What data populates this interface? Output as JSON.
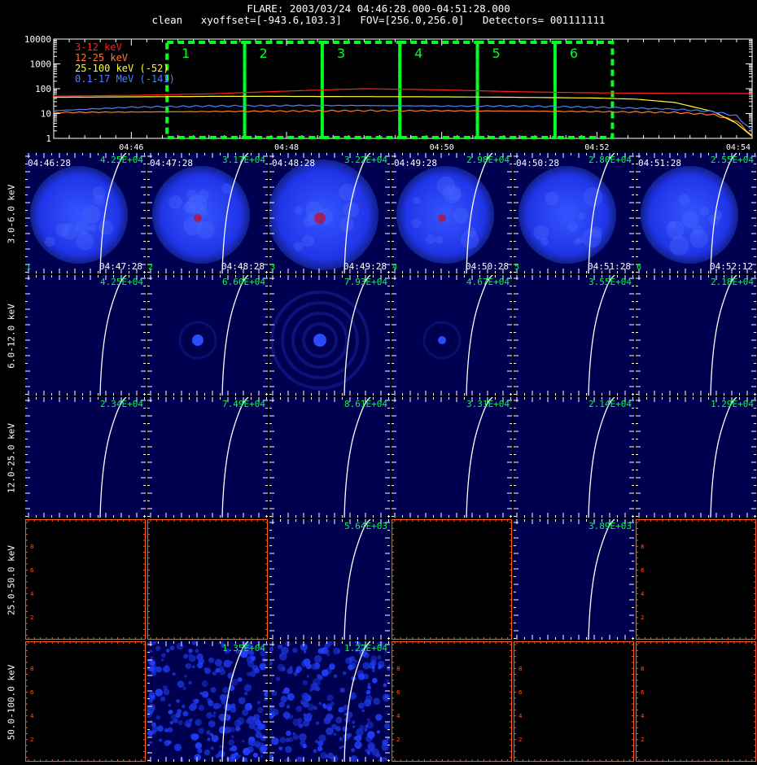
{
  "header": {
    "line1": "FLARE: 2003/03/24 04:46:28.000-04:51:28.000",
    "line2": "clean   xyoffset=[-943.6,103.3]   FOV=[256.0,256.0]   Detectors= 001111111"
  },
  "chart_data": [
    {
      "type": "line",
      "yscale": "log",
      "ylim": [
        1,
        10000
      ],
      "y_ticks": [
        "1",
        "10",
        "100",
        "1000",
        "10000"
      ],
      "x_ticks": [
        "04:46",
        "04:48",
        "04:50",
        "04:52",
        "04:54"
      ],
      "xlim_minutes": [
        0,
        9
      ],
      "x_minutes_of": "04:45",
      "series": [
        {
          "name": "3-12 keV",
          "color": "#ff2020",
          "x": [
            0,
            1,
            2,
            3,
            3.5,
            4,
            5,
            6,
            7,
            8,
            9
          ],
          "values": [
            50,
            54,
            62,
            80,
            90,
            100,
            90,
            75,
            68,
            65,
            64
          ]
        },
        {
          "name": "12-25 keV",
          "color": "#ff7a30",
          "x": [
            0,
            1,
            2,
            3,
            4,
            5,
            6,
            7,
            8,
            8.5,
            8.8,
            9
          ],
          "values": [
            11,
            11.5,
            12,
            12.5,
            13,
            13,
            12.5,
            12,
            11,
            9,
            5,
            1.3
          ]
        },
        {
          "name": "25-100 keV (-52)",
          "color": "#ffff33",
          "x": [
            0,
            1,
            2,
            3,
            4,
            5,
            6,
            7,
            7.5,
            8,
            8.5,
            8.8,
            9
          ],
          "values": [
            45,
            47,
            49,
            49,
            48,
            47,
            45,
            42,
            38,
            28,
            12,
            4,
            1.2
          ]
        },
        {
          "name": "0.1-17 MeV (-141)",
          "color": "#4f7fff",
          "x": [
            0,
            1,
            2,
            3,
            4,
            5,
            6,
            7,
            8,
            8.5,
            8.8,
            9
          ],
          "values": [
            13,
            18,
            20,
            21,
            21,
            20,
            20,
            18,
            15,
            12,
            8,
            2
          ]
        }
      ],
      "intervals": [
        "1",
        "2",
        "3",
        "4",
        "5",
        "6"
      ],
      "interval_bounds_minutes": [
        1.46,
        2.46,
        3.46,
        4.46,
        5.46,
        6.46,
        7.2
      ]
    }
  ],
  "image_grid": {
    "rows": [
      {
        "label": "3.0-6.0 keV",
        "cells": [
          {
            "peak": "4.25E+04",
            "t0": "04:46:28",
            "t1": "04:47:28",
            "idx": "1",
            "img": "disk"
          },
          {
            "peak": "3.17E+04",
            "t0": "04:47:28",
            "t1": "04:48:28",
            "idx": "2",
            "img": "disk"
          },
          {
            "peak": "3.22E+04",
            "t0": "04:48:28",
            "t1": "04:49:28",
            "idx": "3",
            "img": "disk"
          },
          {
            "peak": "2.98E+04",
            "t0": "04:49:28",
            "t1": "04:50:28",
            "idx": "4",
            "img": "disk"
          },
          {
            "peak": "2.80E+04",
            "t0": "04:50:28",
            "t1": "04:51:28",
            "idx": "5",
            "img": "disk"
          },
          {
            "peak": "2.55E+04",
            "t0": "04:51:28",
            "t1": "04:52:12",
            "idx": "6",
            "img": "disk"
          }
        ]
      },
      {
        "label": "6.0-12.0 keV",
        "cells": [
          {
            "peak": "4.25E+04",
            "img": "dark"
          },
          {
            "peak": "6.60E+04",
            "img": "source"
          },
          {
            "peak": "7.93E+04",
            "img": "rings"
          },
          {
            "peak": "4.67E+04",
            "img": "source"
          },
          {
            "peak": "3.55E+04",
            "img": "dark"
          },
          {
            "peak": "2.18E+04",
            "img": "dark"
          }
        ]
      },
      {
        "label": "12.0-25.0 keV",
        "cells": [
          {
            "peak": "2.34E+04",
            "img": "dark"
          },
          {
            "peak": "7.49E+04",
            "img": "dark"
          },
          {
            "peak": "8.61E+04",
            "img": "dark"
          },
          {
            "peak": "3.31E+04",
            "img": "dark"
          },
          {
            "peak": "2.14E+04",
            "img": "dark"
          },
          {
            "peak": "1.29E+04",
            "img": "dark"
          }
        ]
      },
      {
        "label": "25.0-50.0 keV",
        "cells": [
          {
            "peak": "",
            "img": "empty"
          },
          {
            "peak": "",
            "img": "empty"
          },
          {
            "peak": "5.64E+03",
            "img": "dark"
          },
          {
            "peak": "",
            "img": "empty"
          },
          {
            "peak": "3.89E+03",
            "img": "dark"
          },
          {
            "peak": "",
            "img": "empty"
          }
        ]
      },
      {
        "label": "50.0-100.0 keV",
        "cells": [
          {
            "peak": "",
            "img": "empty"
          },
          {
            "peak": "1.35E+04",
            "img": "noise"
          },
          {
            "peak": "1.22E+04",
            "img": "noise"
          },
          {
            "peak": "",
            "img": "empty"
          },
          {
            "peak": "",
            "img": "empty"
          },
          {
            "peak": "",
            "img": "empty"
          }
        ]
      }
    ],
    "empty_axis_ticks": [
      "2",
      "4",
      "6",
      "8"
    ]
  },
  "colors": {
    "background": "#000000",
    "interval_box": "#00ff22",
    "peak_label": "#00ff3c",
    "axis_orange": "#ff5a1e",
    "image_blue": "#2846ff",
    "image_dark": "#000050",
    "source_red": "#b4143c"
  }
}
